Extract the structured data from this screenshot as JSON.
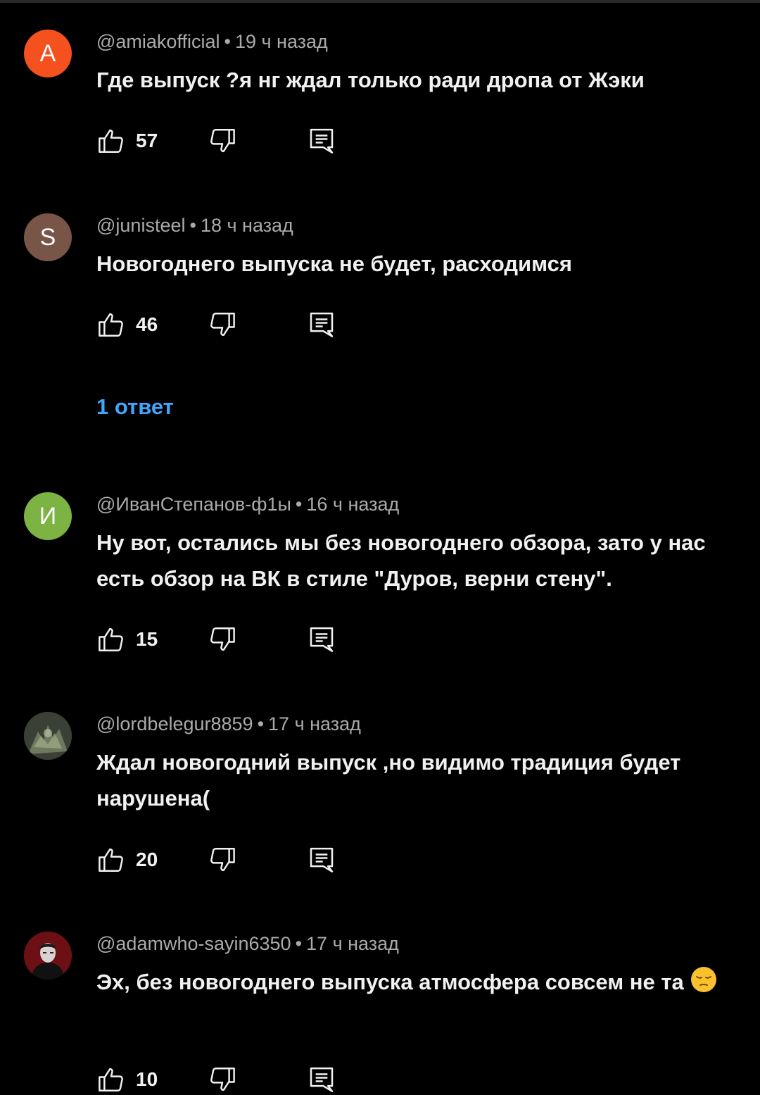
{
  "colors": {
    "background": "#000000",
    "text": "#f1f1f1",
    "meta": "#aaaaaa",
    "link": "#3ea6ff"
  },
  "icons": {
    "like": "thumb-up-icon",
    "dislike": "thumb-down-icon",
    "reply": "reply-icon"
  },
  "comments": [
    {
      "avatar_letter": "A",
      "avatar_color": "#f4511e",
      "author": "@amiakofficial",
      "time": "19 ч назад",
      "text": "Где выпуск ?я нг  ждал только ради дропа от Жэки",
      "likes": "57"
    },
    {
      "avatar_letter": "S",
      "avatar_color": "#795548",
      "author": "@junisteel",
      "time": "18 ч назад",
      "text": "Новогоднего выпуска не будет, расходимся",
      "likes": "46",
      "replies_label": "1 ответ"
    },
    {
      "avatar_letter": "И",
      "avatar_color": "#7cb342",
      "author": "@ИванСтепанов-ф1ы",
      "time": "16 ч назад",
      "text": "Ну вот, остались мы без новогоднего обзора, зато у нас есть обзор на ВК в стиле \"Дуров, верни стену\".",
      "likes": "15"
    },
    {
      "avatar_letter": "",
      "avatar_color": "#2e3a2e",
      "author": "@lordbelegur8859",
      "time": "17 ч назад",
      "text": "Ждал новогодний выпуск ,но видимо традиция будет нарушена(",
      "likes": "20"
    },
    {
      "avatar_letter": "",
      "avatar_color": "#5a0d12",
      "author": "@adamwho-sayin6350",
      "time": "17 ч назад",
      "text": "Эх, без новогоднего выпуска атмосфера совсем не та",
      "emoji": "pensive-face-emoji",
      "likes": "10"
    }
  ]
}
